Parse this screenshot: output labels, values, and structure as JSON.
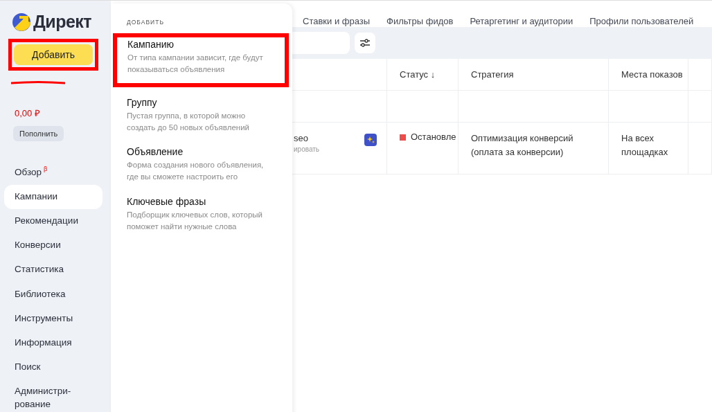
{
  "logo": {
    "text": "Директ"
  },
  "sidebar": {
    "add_button": {
      "label": "Добавить",
      "highlighted": true
    },
    "account_redacted": true,
    "balance": "0,00 ₽",
    "top_up_button": "Пополнить",
    "nav": [
      {
        "label": "Обзор",
        "badge": "β",
        "selected": false
      },
      {
        "label": "Кампании",
        "selected": true
      },
      {
        "label": "Рекомендации",
        "selected": false
      },
      {
        "label": "Конверсии",
        "selected": false
      },
      {
        "label": "Статистика",
        "selected": false
      },
      {
        "label": "Библиотека",
        "selected": false
      },
      {
        "label": "Инструменты",
        "selected": false
      },
      {
        "label": "Информация",
        "selected": false
      },
      {
        "label": "Поиск",
        "selected": false
      },
      {
        "label": "Администри-\nрование",
        "selected": false
      }
    ]
  },
  "add_menu": {
    "title": "ДОБАВИТЬ",
    "items": [
      {
        "title": "Кампанию",
        "description": "От типа кампании зависит, где будут показываться объявления",
        "highlighted": true
      },
      {
        "title": "Группу",
        "description": "Пустая группа, в которой можно создать до 50 новых объявлений",
        "highlighted": false
      },
      {
        "title": "Объявление",
        "description": "Форма создания нового объявления, где вы сможете настроить его",
        "highlighted": false
      },
      {
        "title": "Ключевые фразы",
        "description": "Подборщик ключевых слов, который поможет найти нужные слова",
        "highlighted": false
      }
    ]
  },
  "tabs": [
    "Ставки и фразы",
    "Фильтры фидов",
    "Ретаргетинг и аудитории",
    "Профили пользователей"
  ],
  "table": {
    "columns": [
      "Статус ↓",
      "Стратегия",
      "Места показов"
    ],
    "rows": [
      {
        "kind": "empty"
      },
      {
        "kind": "campaign",
        "name": "seo",
        "subtext": "ировать",
        "status": {
          "label": "Остановле",
          "color": "#f04b4b"
        },
        "strategy": "Оптимизация конверсий (оплата за конверсии)",
        "places": "На всех площадках"
      }
    ]
  }
}
